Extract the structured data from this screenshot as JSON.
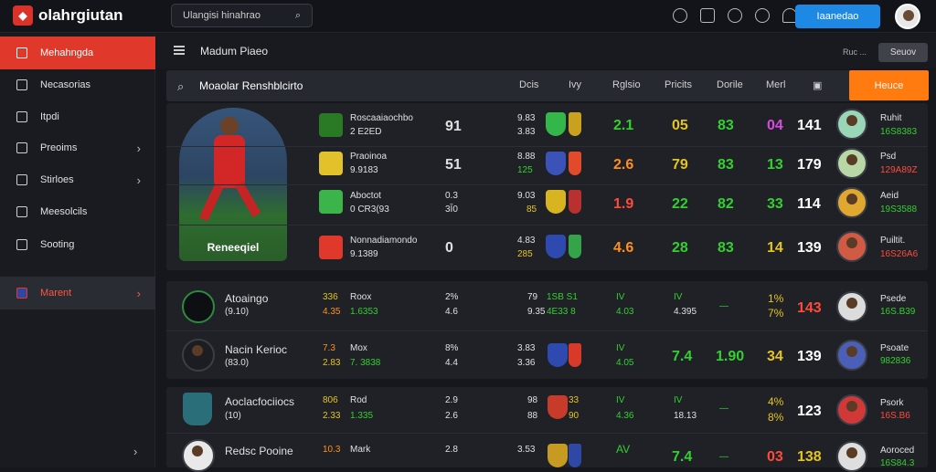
{
  "app": {
    "name": "olahrgiutan"
  },
  "search": {
    "placeholder": "Ulangisi hinahrao"
  },
  "header": {
    "cta": "Iaanedao"
  },
  "sidebar": {
    "items": [
      {
        "label": "Mehahngda"
      },
      {
        "label": "Necasorias"
      },
      {
        "label": "Itpdi"
      },
      {
        "label": "Preoims"
      },
      {
        "label": "Stirloes"
      },
      {
        "label": "Meesolcils"
      },
      {
        "label": "Sooting"
      },
      {
        "label": "Marent"
      }
    ]
  },
  "subheader": {
    "title": "Madum Piaeo",
    "small": "Ruc ...",
    "button": "Seuov"
  },
  "table": {
    "title": "Moaolar Renshblcirto",
    "headers": [
      "Dcis",
      "Ivy",
      "Rglsio",
      "Pricits",
      "Dorile",
      "Merl"
    ],
    "action": "Heuce",
    "hero_name": "Reneeqiel",
    "rows": [
      {
        "name": "Roscaaiaochbo",
        "sub": "2 E2ED",
        "pos": "91",
        "s1": "9.83",
        "s2": "3.83",
        "v1": "2.1",
        "v2": "05",
        "v3": "83",
        "v4": "04",
        "v5": "141",
        "pname": "Ruhit",
        "pval": "16S8383"
      },
      {
        "name": "Praoinoa",
        "sub": "9.9183",
        "pos": "51",
        "s1": "8.88",
        "s2": "125",
        "v1": "2.6",
        "v2": "79",
        "v3": "83",
        "v4": "13",
        "v5": "179",
        "pname": "Psd",
        "pval": "129A89Z"
      },
      {
        "name": "Aboctot",
        "sub": "0 CR3(93",
        "pos": "0.3",
        "pos2": "3Ĭ0",
        "s1": "9.03",
        "s2": "85",
        "v1": "1.9",
        "v2": "22",
        "v3": "82",
        "v4": "33",
        "v5": "114",
        "pname": "Aeid",
        "pval": "19S3588"
      },
      {
        "name": "Nonnadiamondo",
        "sub": "9.1389",
        "pos": "0",
        "s1": "4.83",
        "s2": "285",
        "v1": "4.6",
        "v2": "28",
        "v3": "83",
        "v4": "14",
        "v5": "139",
        "pname": "Puiltit.",
        "pval": "16S26A6"
      }
    ],
    "rows2": [
      {
        "name": "Atoaingo",
        "sub": "(9.10)",
        "a1": "336",
        "a2": "4.35",
        "b1": "Roox",
        "b2": "1.6353",
        "c1": "2%",
        "c2": "4.6",
        "d1": "79",
        "d2": "9.35",
        "e1": "1SB S1",
        "e2": "4E33 8",
        "f1": "IV",
        "f2": "4.03",
        "g1": "IV",
        "g2": "4.395",
        "h": "—",
        "i1": "1%",
        "i2": "7%",
        "j": "143",
        "pname": "Psede",
        "pval": "16S.B39"
      },
      {
        "name": "Nacin Kerioc",
        "sub": "(83.0)",
        "a1": "7.3",
        "a2": "2.83",
        "b1": "Mox",
        "b2": "7. 3838",
        "c1": "8%",
        "c2": "4.4",
        "d1": "3.83",
        "d2": "3.36",
        "e1": "",
        "e2": "",
        "f1": "IV",
        "f2": "4.05",
        "g1": "7.4",
        "g2": "",
        "h": "1.90",
        "i1": "34",
        "i2": "",
        "j": "139",
        "pname": "Psoate",
        "pval": "982836"
      },
      {
        "name": "Aoclacfociiocs",
        "sub": "(10)",
        "a1": "806",
        "a2": "2.33",
        "b1": "Rod",
        "b2": "1.335",
        "c1": "2.9",
        "c2": "2.6",
        "d1": "98",
        "d2": "88",
        "e1": "33",
        "e2": "90",
        "f1": "IV",
        "f2": "4.36",
        "g1": "IV",
        "g2": "18.13",
        "h": "—",
        "i1": "4%",
        "i2": "8%",
        "j": "123",
        "pname": "Psork",
        "pval": "16S.B6"
      },
      {
        "name": "Redsc Pooine",
        "sub": "(2.9)",
        "a1": "10.3",
        "a2": "",
        "b1": "Mark",
        "b2": "",
        "c1": "2.8",
        "c2": "",
        "d1": "3.53",
        "d2": "",
        "e1": "",
        "e2": "",
        "f1": "AV",
        "f2": "",
        "g1": "7.4",
        "g2": "",
        "h": "—",
        "i1": "03",
        "i2": "",
        "j": "138",
        "pname": "Aoroced",
        "pval": "16S84.3"
      }
    ]
  },
  "colors": {
    "accent": "#e0392b",
    "cta": "#1e88e5",
    "orange": "#ff7a0f",
    "green": "#34d02f"
  }
}
